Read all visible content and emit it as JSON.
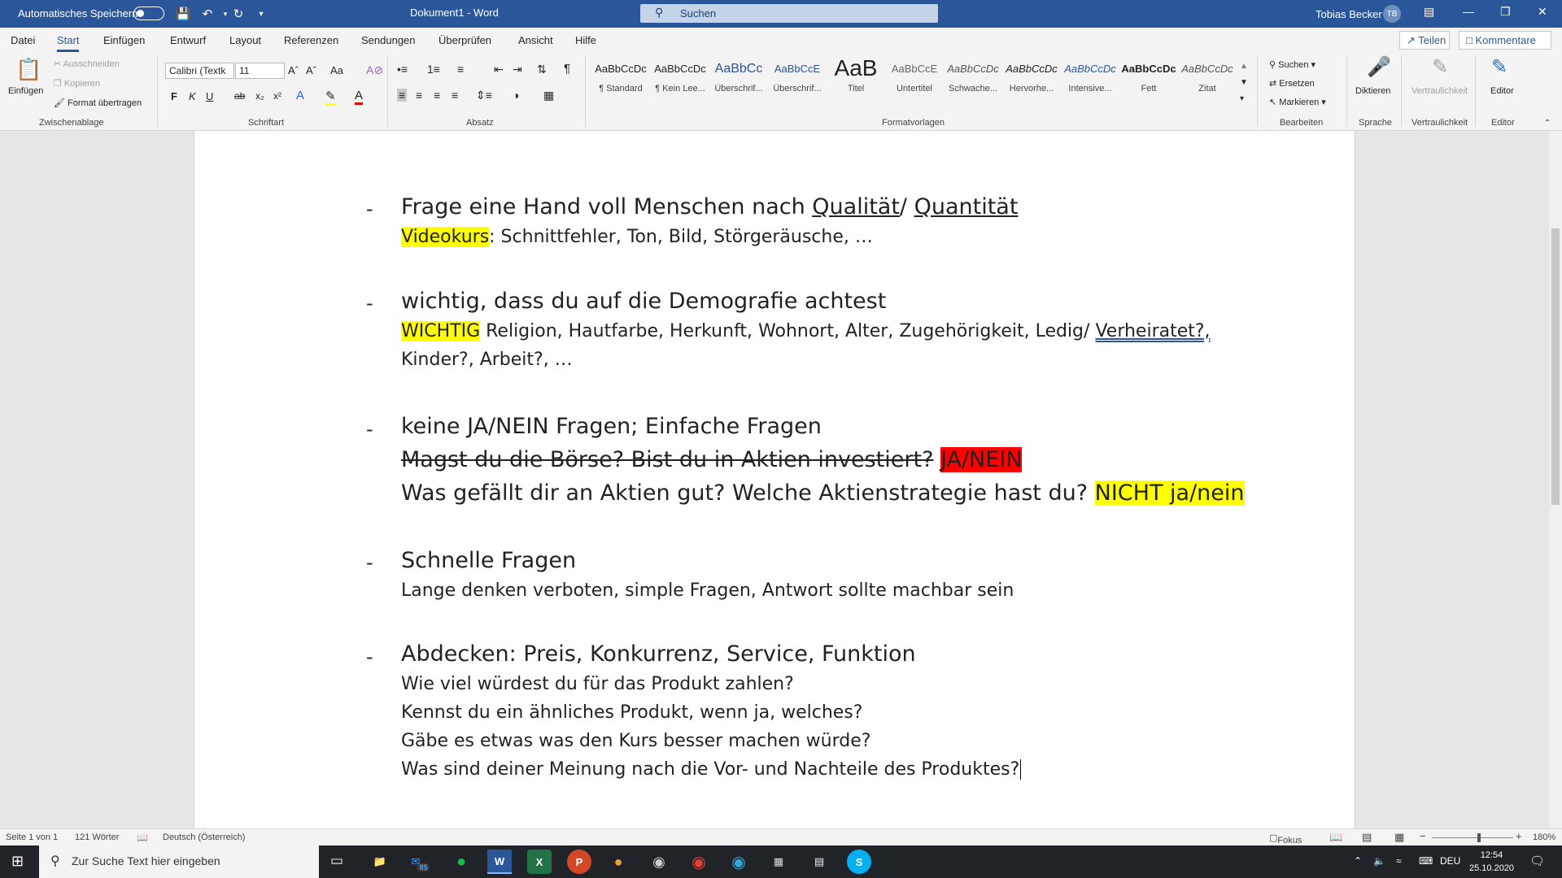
{
  "titlebar": {
    "autosave_label": "Automatisches Speichern",
    "doc_title": "Dokument1 - Word",
    "search_label": "Suchen",
    "user_name": "Tobias Becker",
    "user_initials": "TB"
  },
  "tabs": [
    "Datei",
    "Start",
    "Einfügen",
    "Entwurf",
    "Layout",
    "Referenzen",
    "Sendungen",
    "Überprüfen",
    "Ansicht",
    "Hilfe"
  ],
  "active_tab": "Start",
  "share_label": "Teilen",
  "comments_label": "Kommentare",
  "ribbon": {
    "clipboard": {
      "paste": "Einfügen",
      "cut": "Ausschneiden",
      "copy": "Kopieren",
      "format_painter": "Format übertragen",
      "group": "Zwischenablage"
    },
    "font": {
      "name": "Calibri (Textk",
      "size": "11",
      "group": "Schriftart",
      "bold": "F",
      "italic": "K",
      "underline": "U",
      "strike": "ab",
      "sub": "x₂",
      "sup": "x²",
      "case": "Aa"
    },
    "paragraph": {
      "group": "Absatz"
    },
    "styles": {
      "group": "Formatvorlagen",
      "items": [
        {
          "preview": "AaBbCcDc",
          "name": "¶ Standard"
        },
        {
          "preview": "AaBbCcDc",
          "name": "¶ Kein Lee..."
        },
        {
          "preview": "AaBbCc",
          "name": "Überschrif..."
        },
        {
          "preview": "AaBbCcE",
          "name": "Überschrif..."
        },
        {
          "preview": "AaB",
          "name": "Titel"
        },
        {
          "preview": "AaBbCcE",
          "name": "Untertitel"
        },
        {
          "preview": "AaBbCcDc",
          "name": "Schwache..."
        },
        {
          "preview": "AaBbCcDc",
          "name": "Hervorhe..."
        },
        {
          "preview": "AaBbCcDc",
          "name": "Intensive..."
        },
        {
          "preview": "AaBbCcDc",
          "name": "Fett"
        },
        {
          "preview": "AaBbCcDc",
          "name": "Zitat"
        }
      ]
    },
    "editing": {
      "group": "Bearbeiten",
      "find": "Suchen",
      "replace": "Ersetzen",
      "select": "Markieren"
    },
    "voice": {
      "group": "Sprache",
      "dictate": "Diktieren"
    },
    "sensitivity": {
      "group": "Vertraulichkeit",
      "label": "Vertraulichkeit"
    },
    "editor": {
      "group": "Editor",
      "label": "Editor"
    }
  },
  "document": {
    "b1_head_a": "Frage eine Hand voll Menschen nach ",
    "b1_head_u1": "Qualität",
    "b1_head_b": "/ ",
    "b1_head_u2": "Quantität",
    "b1_sub_hl": "Videokurs",
    "b1_sub_rest": ": Schnittfehler, Ton, Bild, Störgeräusche, …",
    "b2_head": "wichtig, dass du auf die Demografie achtest",
    "b2_sub_hl": "WICHTIG",
    "b2_sub_rest": " Religion, Hautfarbe, Herkunft, Wohnort, Alter, Zugehörigkeit, Ledig/ ",
    "b2_sub_u": "Verheiratet?,",
    "b2_sub2": "Kinder?, Arbeit?, …",
    "b3_head": "keine JA/NEIN Fragen; Einfache Fragen",
    "b3_strike": "Magst du die Börse? Bist du in Aktien investiert?",
    "b3_red": "JA/NEIN",
    "b3_line": "Was gefällt dir an Aktien gut? Welche Aktienstrategie hast du? ",
    "b3_hl": "NICHT ja/nein",
    "b4_head": "Schnelle Fragen",
    "b4_sub": "Lange denken verboten, simple Fragen, Antwort sollte machbar sein",
    "b5_head": "Abdecken: Preis, Konkurrenz, Service, Funktion",
    "b5_l1": "Wie viel würdest du für das Produkt zahlen?",
    "b5_l2": "Kennst du ein ähnliches Produkt, wenn ja, welches?",
    "b5_l3": "Gäbe es etwas was den Kurs besser machen würde?",
    "b5_l4": "Was sind deiner Meinung nach die Vor- und Nachteile des Produktes?",
    "dash": "-"
  },
  "statusbar": {
    "page": "Seite 1 von 1",
    "words": "121 Wörter",
    "language": "Deutsch (Österreich)",
    "focus": "Fokus",
    "zoom": "180%"
  },
  "taskbar": {
    "search_placeholder": "Zur Suche Text hier eingeben",
    "language": "DEU",
    "time": "12:54",
    "date": "25.10.2020",
    "mail_badge": "85"
  },
  "colors": {
    "word_blue": "#2b579a",
    "highlight_yellow": "#ffff00",
    "highlight_red": "#ff0000"
  }
}
